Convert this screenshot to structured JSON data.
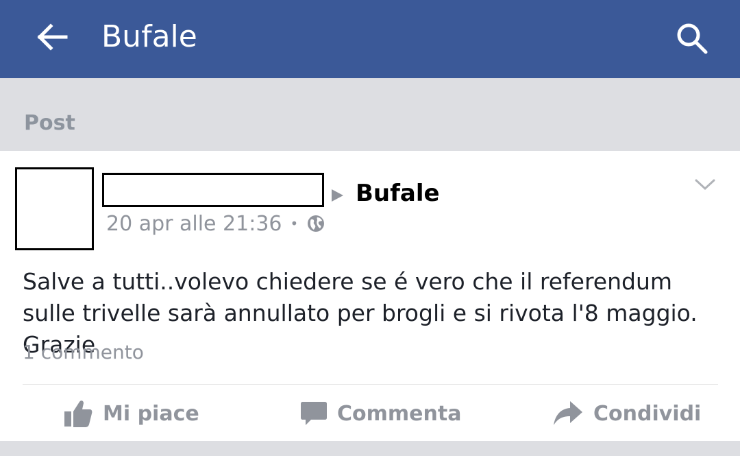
{
  "appbar": {
    "title": "Bufale",
    "back_icon": "arrow-left-icon",
    "search_icon": "search-icon",
    "color": "#3b5998"
  },
  "section": {
    "label": "Post"
  },
  "post": {
    "group_name": "Bufale",
    "timestamp": "20 apr alle 21:36",
    "separator": "•",
    "privacy_icon": "globe-icon",
    "text": "Salve a tutti..volevo chiedere se é vero che il referendum sulle trivelle sarà annullato per brogli e si rivota l'8 maggio. Grazie",
    "comments_count": "1 commento"
  },
  "actions": {
    "like": "Mi piace",
    "comment": "Commenta",
    "share": "Condividi"
  }
}
